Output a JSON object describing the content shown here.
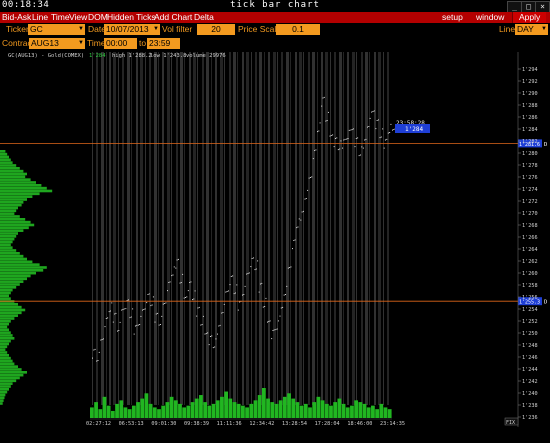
{
  "window": {
    "clock": "00:18:34",
    "title": "tick bar chart",
    "buttons": [
      "_",
      "□",
      "×"
    ]
  },
  "menu": {
    "items": [
      "Bid-Ask",
      "Line",
      "Time",
      "View",
      "DOM",
      "Hidden Ticks",
      "Add Chart",
      "Delta"
    ],
    "right": [
      "setup",
      "window",
      "Apply"
    ]
  },
  "controls": {
    "ticker_label": "Ticker",
    "ticker": "GC",
    "date_label": "Date",
    "date": "10/07/2013",
    "vol_filter_label": "Vol filter",
    "vol_filter": "20",
    "price_scale_label": "Price Scale",
    "price_scale": "0.1",
    "line_label": "Line",
    "line": "DAY",
    "contract_label": "Contract",
    "contract": "AUG13",
    "time_label": "Time",
    "time_from": "00:00",
    "time_to_label": "to",
    "time_to": "23:59"
  },
  "info": {
    "symbol": "GC(AUG13) - Gold(COMEX)",
    "last": "1'284",
    "high": "high 1'288.2",
    "low": "low 1'243.8",
    "volume": "volume 29976"
  },
  "cursor": {
    "time": "23:58:28",
    "price": "1'284"
  },
  "chart_data": {
    "type": "line",
    "ylim": [
      1236,
      1296
    ],
    "yticks": [
      1236,
      1238,
      1240,
      1242,
      1244,
      1246,
      1248,
      1250,
      1252,
      1254,
      1256,
      1258,
      1260,
      1262,
      1264,
      1266,
      1268,
      1270,
      1272,
      1274,
      1276,
      1278,
      1280,
      1282,
      1284,
      1286,
      1288,
      1290,
      1292,
      1294
    ],
    "ytick_labels": [
      "1'236",
      "1'238",
      "1'240",
      "1'242",
      "1'244",
      "1'246",
      "1'248",
      "1'250",
      "1'252",
      "1'254",
      "1'256",
      "1'258",
      "1'260",
      "1'262",
      "1'264",
      "1'266",
      "1'268",
      "1'270",
      "1'272",
      "1'274",
      "1'276",
      "1'278",
      "1'280",
      "1'282",
      "1'284",
      "1'286",
      "1'288",
      "1'290",
      "1'292",
      "1'294"
    ],
    "x_labels": [
      "02:27:12",
      "06:53:13",
      "09:01:30",
      "09:38:39",
      "11:11:36",
      "12:34:42",
      "13:28:54",
      "17:28:04",
      "18:46:00",
      "23:14:35"
    ],
    "price_series": [
      1247,
      1246,
      1249,
      1252,
      1254,
      1253,
      1251,
      1254,
      1255,
      1253,
      1251,
      1252,
      1254,
      1256,
      1255,
      1253,
      1252,
      1255,
      1258,
      1260,
      1262,
      1259,
      1256,
      1258,
      1256,
      1254,
      1252,
      1250,
      1249,
      1248,
      1251,
      1254,
      1257,
      1259,
      1257,
      1255,
      1257,
      1260,
      1262,
      1261,
      1258,
      1255,
      1252,
      1250,
      1251,
      1254,
      1257,
      1261,
      1265,
      1268,
      1270,
      1273,
      1276,
      1280,
      1284,
      1289,
      1286,
      1283,
      1282,
      1281,
      1282,
      1283,
      1284,
      1282,
      1280,
      1282,
      1285,
      1287,
      1285,
      1283,
      1282,
      1284,
      1284
    ],
    "volume": [
      6,
      9,
      5,
      12,
      7,
      4,
      8,
      10,
      6,
      5,
      7,
      9,
      11,
      14,
      8,
      6,
      5,
      7,
      9,
      12,
      10,
      8,
      6,
      7,
      9,
      11,
      13,
      9,
      7,
      8,
      10,
      12,
      15,
      11,
      9,
      8,
      7,
      6,
      8,
      10,
      13,
      17,
      11,
      9,
      8,
      10,
      12,
      14,
      11,
      9,
      7,
      8,
      6,
      9,
      12,
      10,
      8,
      7,
      9,
      11,
      8,
      6,
      7,
      10,
      9,
      8,
      6,
      7,
      5,
      8,
      6,
      5
    ],
    "profile": [
      6,
      8,
      10,
      12,
      14,
      18,
      22,
      26,
      30,
      28,
      34,
      40,
      46,
      52,
      58,
      44,
      36,
      30,
      26,
      24,
      20,
      18,
      16,
      22,
      28,
      34,
      38,
      32,
      26,
      20,
      18,
      16,
      14,
      12,
      14,
      18,
      22,
      26,
      30,
      36,
      44,
      52,
      48,
      40,
      34,
      30,
      26,
      22,
      18,
      14,
      12,
      10,
      12,
      16,
      20,
      24,
      28,
      24,
      20,
      16,
      12,
      10,
      8,
      10,
      12,
      14,
      16,
      12,
      10,
      8,
      6,
      8,
      10,
      12,
      14,
      16,
      20,
      24,
      30,
      26,
      22,
      18,
      14,
      12,
      10,
      8,
      6,
      5,
      4,
      3
    ],
    "reference_lines": [
      {
        "price": 1281.6,
        "label": "1'281.6",
        "color": "#e0671b"
      },
      {
        "price": 1255.3,
        "label": "1'255.3",
        "color": "#e0671b"
      }
    ]
  }
}
